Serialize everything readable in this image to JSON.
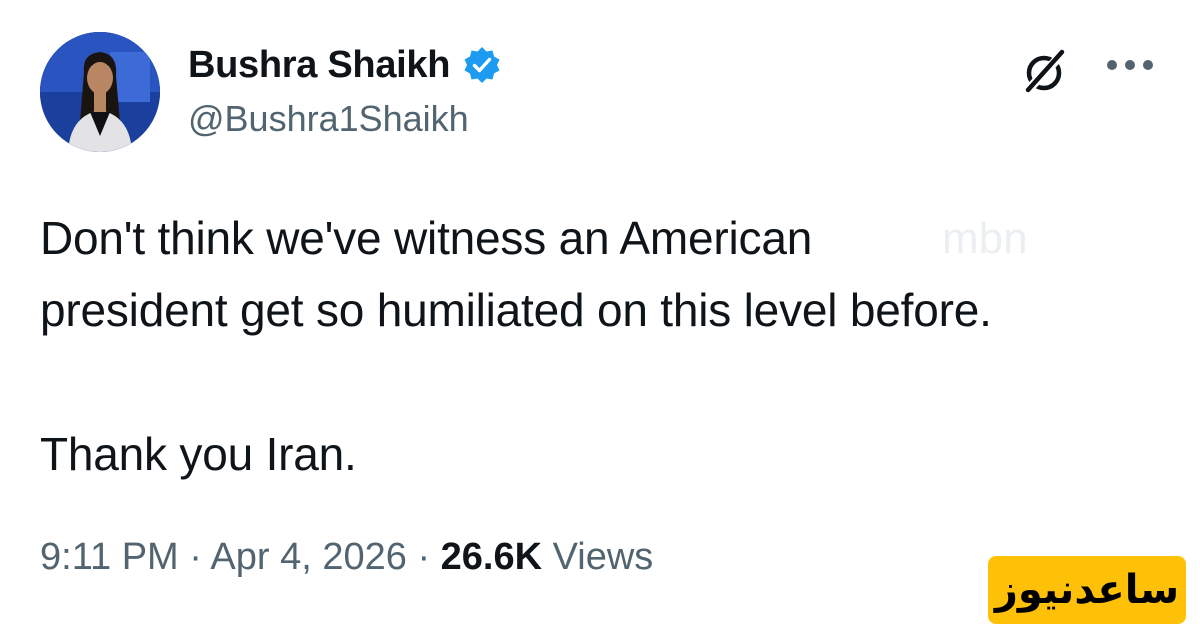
{
  "author": {
    "display_name": "Bushra Shaikh",
    "handle": "@Bushra1Shaikh",
    "verified": true
  },
  "tweet": {
    "line1": "Don't think we've witness an American",
    "line2": "president get so humiliated on this level before.",
    "line3": "Thank you Iran."
  },
  "meta": {
    "time": "9:11 PM",
    "separator": "·",
    "date": "Apr 4, 2026",
    "view_count": "26.6K",
    "views_label": "Views"
  },
  "watermarks": {
    "faint_text": "mbn",
    "badge_text": "ساعدنیوز"
  },
  "icons": {
    "verified": "verified-badge-icon",
    "grok": "grok-icon",
    "more": "more-options-icon"
  },
  "colors": {
    "verified_blue": "#1d9bf0",
    "text_primary": "#0f1419",
    "text_secondary": "#536471",
    "badge_yellow": "#ffc107",
    "avatar_bg": "#1a3f9c"
  }
}
